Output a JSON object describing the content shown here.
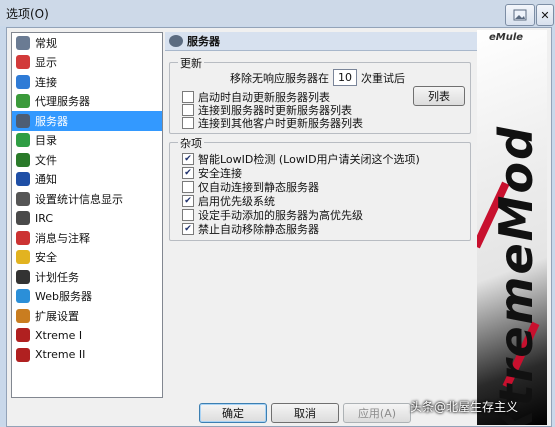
{
  "window": {
    "title": "选项(O)"
  },
  "tree": {
    "items": [
      {
        "label": "常规",
        "icon": "general-icon",
        "color": "#6a7b93"
      },
      {
        "label": "显示",
        "icon": "display-icon",
        "color": "#d23a3a"
      },
      {
        "label": "连接",
        "icon": "connection-icon",
        "color": "#2f7bd6"
      },
      {
        "label": "代理服务器",
        "icon": "proxy-icon",
        "color": "#3b9a3b"
      },
      {
        "label": "服务器",
        "icon": "server-icon",
        "color": "#4d5d74",
        "selected": true
      },
      {
        "label": "目录",
        "icon": "directory-icon",
        "color": "#2f9e44"
      },
      {
        "label": "文件",
        "icon": "file-icon",
        "color": "#2a7a2a"
      },
      {
        "label": "通知",
        "icon": "notify-icon",
        "color": "#1f4fa6"
      },
      {
        "label": "设置统计信息显示",
        "icon": "stats-icon",
        "color": "#555555"
      },
      {
        "label": "IRC",
        "icon": "irc-icon",
        "color": "#4a4a4a"
      },
      {
        "label": "消息与注释",
        "icon": "message-icon",
        "color": "#c33"
      },
      {
        "label": "安全",
        "icon": "security-icon",
        "color": "#e2b320"
      },
      {
        "label": "计划任务",
        "icon": "scheduler-icon",
        "color": "#333"
      },
      {
        "label": "Web服务器",
        "icon": "web-icon",
        "color": "#2b8fd8"
      },
      {
        "label": "扩展设置",
        "icon": "extended-icon",
        "color": "#c97d20"
      },
      {
        "label": "Xtreme I",
        "icon": "xtreme1-icon",
        "color": "#b02020"
      },
      {
        "label": "Xtreme II",
        "icon": "xtreme2-icon",
        "color": "#b02020"
      }
    ]
  },
  "panel": {
    "title": "服务器",
    "update": {
      "label": "更新",
      "remove_prefix": "移除无响应服务器在",
      "retry_value": "10",
      "remove_suffix": "次重试后",
      "list_button": "列表",
      "options": [
        {
          "label": "启动时自动更新服务器列表",
          "checked": false
        },
        {
          "label": "连接到服务器时更新服务器列表",
          "checked": false
        },
        {
          "label": "连接到其他客户时更新服务器列表",
          "checked": false
        }
      ]
    },
    "misc": {
      "label": "杂项",
      "options": [
        {
          "label": "智能LowID检测 (LowID用户请关闭这个选项)",
          "checked": true
        },
        {
          "label": "安全连接",
          "checked": true
        },
        {
          "label": "仅自动连接到静态服务器",
          "checked": false
        },
        {
          "label": "启用优先级系统",
          "checked": true
        },
        {
          "label": "设定手动添加的服务器为高优先级",
          "checked": false
        },
        {
          "label": "禁止自动移除静态服务器",
          "checked": true
        }
      ]
    }
  },
  "buttons": {
    "ok": "确定",
    "cancel": "取消",
    "apply": "应用(A)"
  },
  "brand": {
    "vertical_text": "XtremeMod",
    "small_logo": "eMule"
  },
  "watermark": "头条@北屋生存主义",
  "colors": {
    "selection": "#3399ff",
    "title_bar": "#cdd9e8"
  }
}
